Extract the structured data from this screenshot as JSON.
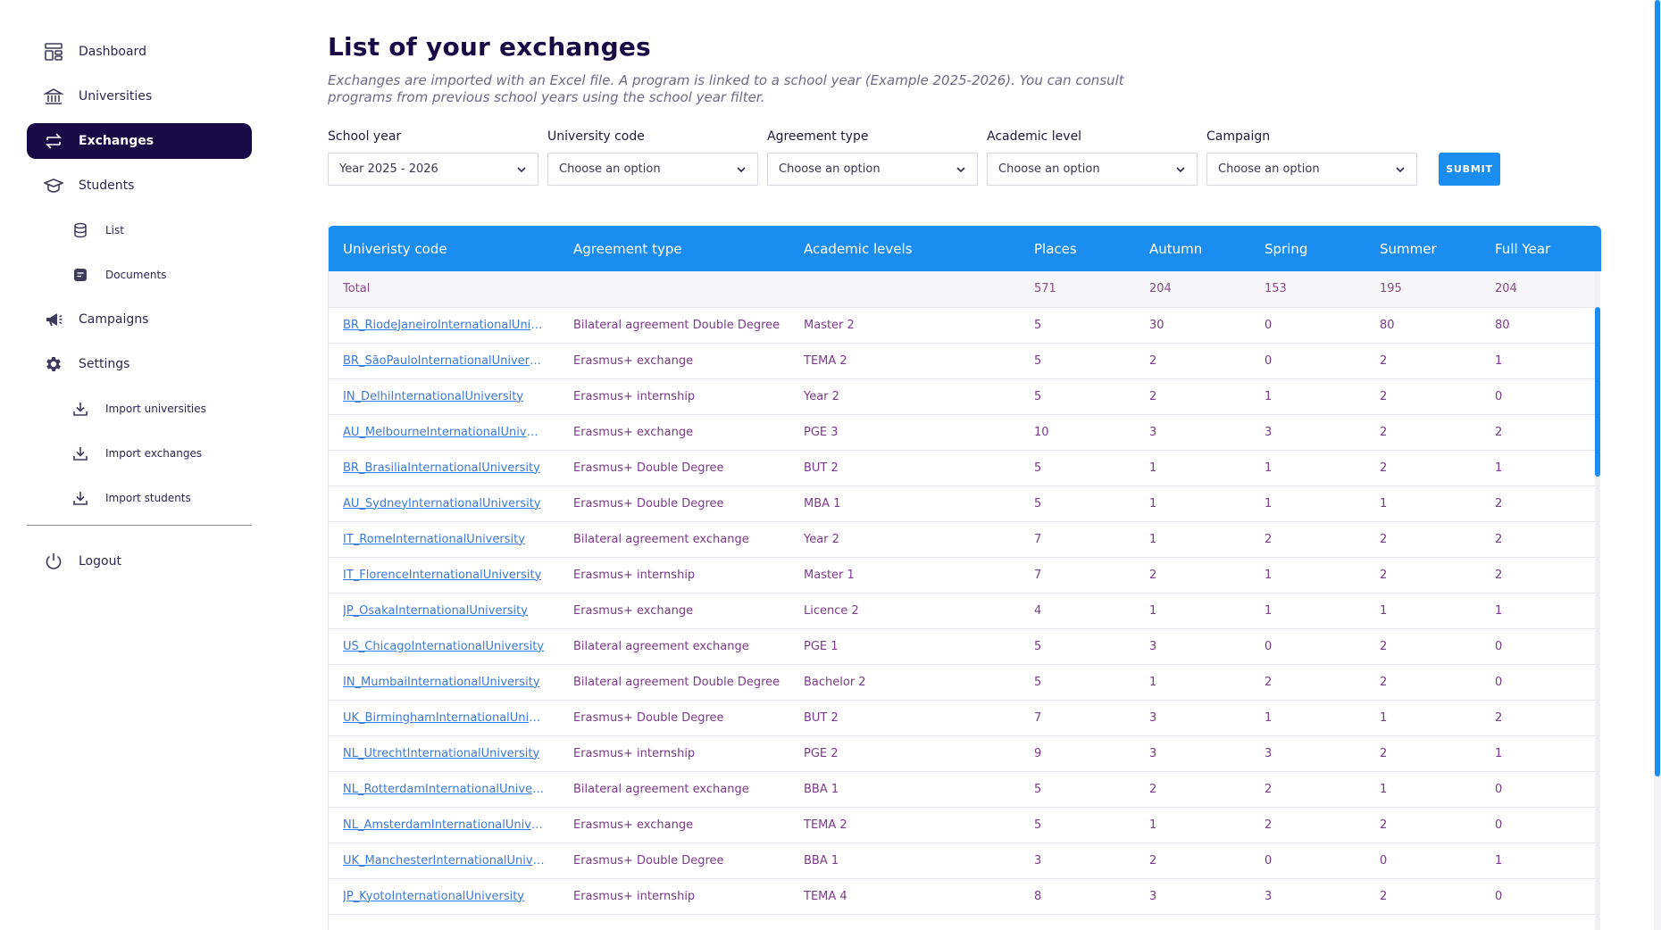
{
  "sidebar": {
    "items": [
      {
        "label": "Dashboard",
        "icon": "dashboard-icon"
      },
      {
        "label": "Universities",
        "icon": "bank-icon"
      },
      {
        "label": "Exchanges",
        "icon": "exchange-icon"
      },
      {
        "label": "Students",
        "icon": "graduation-cap-icon"
      },
      {
        "label": "List",
        "icon": "database-icon"
      },
      {
        "label": "Documents",
        "icon": "document-icon"
      },
      {
        "label": "Campaigns",
        "icon": "megaphone-icon"
      },
      {
        "label": "Settings",
        "icon": "gear-icon"
      },
      {
        "label": "Import universities",
        "icon": "download-icon"
      },
      {
        "label": "Import exchanges",
        "icon": "download-icon"
      },
      {
        "label": "Import students",
        "icon": "download-icon"
      }
    ],
    "logout": "Logout",
    "active": "Exchanges"
  },
  "main": {
    "title": "List of your exchanges",
    "subtitle": "Exchanges are imported with an Excel file. A program is linked to a school year (Example 2025-2026). You can consult programs from previous school years using the school year filter."
  },
  "filters": {
    "school_year": {
      "label": "School year",
      "value": "Year 2025 - 2026"
    },
    "university_code": {
      "label": "University code",
      "value": "Choose an option"
    },
    "agreement_type": {
      "label": "Agreement type",
      "value": "Choose an option"
    },
    "academic_level": {
      "label": "Academic level",
      "value": "Choose an option"
    },
    "campaign": {
      "label": "Campaign",
      "value": "Choose an option"
    },
    "submit_label": "SUBMIT"
  },
  "table": {
    "headers": [
      "Univeristy code",
      "Agreement type",
      "Academic levels",
      "Places",
      "Autumn",
      "Spring",
      "Summer",
      "Full Year"
    ],
    "total": {
      "label": "Total",
      "places": "571",
      "autumn": "204",
      "spring": "153",
      "summer": "195",
      "full_year": "204"
    },
    "rows": [
      [
        "BR_RiodeJaneiroInternationalUnive...",
        "Bilateral agreement Double Degree",
        "Master 2",
        "5",
        "30",
        "0",
        "80",
        "80"
      ],
      [
        "BR_SãoPauloInternationalUniversity",
        "Erasmus+ exchange",
        "TEMA 2",
        "5",
        "2",
        "0",
        "2",
        "1"
      ],
      [
        "IN_DelhiInternationalUniversity",
        "Erasmus+ internship",
        "Year 2",
        "5",
        "2",
        "1",
        "2",
        "0"
      ],
      [
        "AU_MelbourneInternationalUniversity",
        "Erasmus+ exchange",
        "PGE 3",
        "10",
        "3",
        "3",
        "2",
        "2"
      ],
      [
        "BR_BrasiliaInternationalUniversity",
        "Erasmus+ Double Degree",
        "BUT 2",
        "5",
        "1",
        "1",
        "2",
        "1"
      ],
      [
        "AU_SydneyInternationalUniversity",
        "Erasmus+ Double Degree",
        "MBA 1",
        "5",
        "1",
        "1",
        "1",
        "2"
      ],
      [
        "IT_RomeInternationalUniversity",
        "Bilateral agreement exchange",
        "Year 2",
        "7",
        "1",
        "2",
        "2",
        "2"
      ],
      [
        "IT_FlorenceInternationalUniversity",
        "Erasmus+ internship",
        "Master 1",
        "7",
        "2",
        "1",
        "2",
        "2"
      ],
      [
        "JP_OsakaInternationalUniversity",
        "Erasmus+ exchange",
        "Licence 2",
        "4",
        "1",
        "1",
        "1",
        "1"
      ],
      [
        "US_ChicagoInternationalUniversity",
        "Bilateral agreement exchange",
        "PGE 1",
        "5",
        "3",
        "0",
        "2",
        "0"
      ],
      [
        "IN_MumbaiInternationalUniversity",
        "Bilateral agreement Double Degree",
        "Bachelor 2",
        "5",
        "1",
        "2",
        "2",
        "0"
      ],
      [
        "UK_BirminghamInternationalUniver...",
        "Erasmus+ Double Degree",
        "BUT 2",
        "7",
        "3",
        "1",
        "1",
        "2"
      ],
      [
        "NL_UtrechtInternationalUniversity",
        "Erasmus+ internship",
        "PGE 2",
        "9",
        "3",
        "3",
        "2",
        "1"
      ],
      [
        "NL_RotterdamInternationalUniversity",
        "Bilateral agreement exchange",
        "BBA 1",
        "5",
        "2",
        "2",
        "1",
        "0"
      ],
      [
        "NL_AmsterdamInternationalUnivers...",
        "Erasmus+ exchange",
        "TEMA 2",
        "5",
        "1",
        "2",
        "2",
        "0"
      ],
      [
        "UK_ManchesterInternationalUnivers...",
        "Erasmus+ Double Degree",
        "BBA 1",
        "3",
        "2",
        "0",
        "0",
        "1"
      ],
      [
        "JP_KyotoInternationalUniversity",
        "Erasmus+ internship",
        "TEMA 4",
        "8",
        "3",
        "3",
        "2",
        "0"
      ]
    ]
  },
  "colors": {
    "accent": "#1c8df0",
    "nav_active": "#170a45",
    "cell_text": "#7a3a8a",
    "link": "#3b7ad8"
  }
}
